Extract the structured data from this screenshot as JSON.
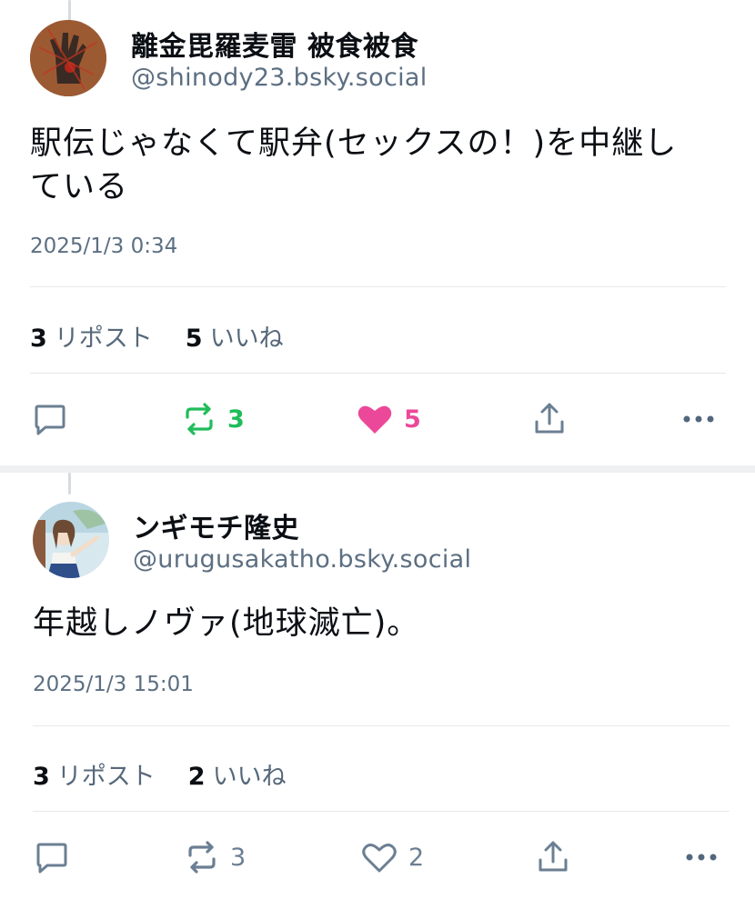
{
  "posts": [
    {
      "author_name": "離金毘羅麦雷 被食被食",
      "handle": "@shinody23.bsky.social",
      "text_line1": "駅伝じゃなくて駅弁(セックスの！)を中継し",
      "text_line2": "ている",
      "timestamp": "2025/1/3 0:34",
      "reposts_count": "3",
      "reposts_label": "リポスト",
      "likes_count": "5",
      "likes_label": "いいね",
      "repost_action_count": "3",
      "like_action_count": "5",
      "reposted": true,
      "liked": true
    },
    {
      "author_name": "ンギモチ隆史",
      "handle": "@urugusakatho.bsky.social",
      "text_line1": "年越しノヴァ(地球滅亡)。",
      "timestamp": "2025/1/3 15:01",
      "reposts_count": "3",
      "reposts_label": "リポスト",
      "likes_count": "2",
      "likes_label": "いいね",
      "repost_action_count": "3",
      "like_action_count": "2",
      "reposted": false,
      "liked": false
    }
  ],
  "colors": {
    "repost_active": "#20bc5a",
    "like_active": "#ec4899",
    "icon_default": "#6b7f93",
    "more_icon": "#52677c"
  },
  "icons": [
    "reply-icon",
    "repost-icon",
    "heart-icon",
    "share-icon",
    "more-icon"
  ]
}
